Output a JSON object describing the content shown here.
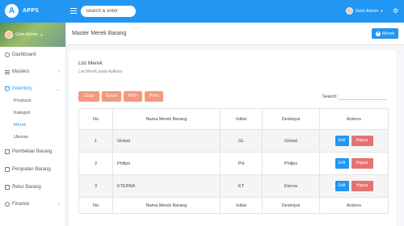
{
  "brand": {
    "name": "APPS",
    "logo_letter": "A"
  },
  "search": {
    "placeholder": "Search & enter"
  },
  "user": {
    "name": "Gets Admin"
  },
  "sidebar": {
    "profile_name": "Gets Admin",
    "items": [
      {
        "label": "Dashboard"
      },
      {
        "label": "Masters"
      },
      {
        "label": "Inventory"
      },
      {
        "label": "Pembelian Barang"
      },
      {
        "label": "Penjualan Barang"
      },
      {
        "label": "Retur Barang"
      },
      {
        "label": "Finance"
      }
    ],
    "inventory_sub": [
      "Products",
      "Kategori",
      "Merek",
      "Ukuran"
    ]
  },
  "page": {
    "title": "Master Merek Barang",
    "add_button": "Merek"
  },
  "card": {
    "title": "List Merek",
    "subtitle": "List Merek pada Aplikasi",
    "export_buttons": [
      "Copy",
      "Excel",
      "PDF",
      "Print"
    ],
    "search_label": "Search:"
  },
  "table": {
    "headers": [
      "No",
      "Nama Merek Barang",
      "Initial",
      "Deskripsi",
      "Actions"
    ],
    "rows": [
      {
        "no": "1",
        "name": "Global",
        "initial": "GL",
        "desc": "Global"
      },
      {
        "no": "2",
        "name": "Philips",
        "initial": "PH",
        "desc": "Philips"
      },
      {
        "no": "3",
        "name": "ETERNA",
        "initial": "ET",
        "desc": "Eterna"
      }
    ],
    "edit_label": "Edit",
    "delete_label": "Hapus"
  },
  "colors": {
    "primary": "#2196f3",
    "export": "#f4997c",
    "danger": "#e57373"
  }
}
